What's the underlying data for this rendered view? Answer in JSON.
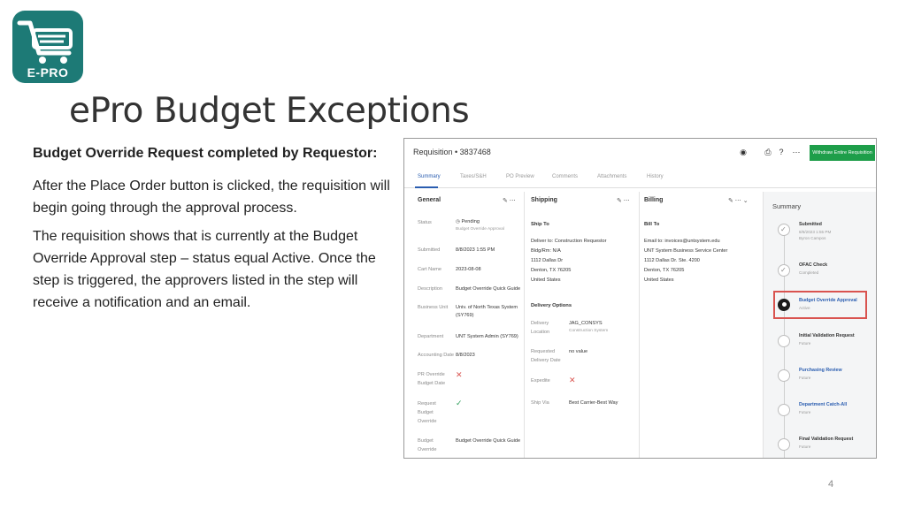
{
  "logo": {
    "text": "E-PRO"
  },
  "slide": {
    "title": "ePro Budget Exceptions",
    "lead": "Budget Override Request completed by Requestor:",
    "para1": "After the Place Order button is clicked, the requisition will begin going through the approval process.",
    "para2": "The requisition shows that is currently at the Budget Override Approval step – status equal Active. Once the step is triggered, the approvers listed in the step will receive a notification and an email.",
    "page_number": "4"
  },
  "screenshot": {
    "requisition_title": "Requisition  •  3837468",
    "header_icons": [
      "eye-icon",
      "print-icon",
      "help-icon",
      "more-icon"
    ],
    "withdraw_button": "Withdraw Entire Requisition",
    "tabs": [
      "Summary",
      "Taxes/S&H",
      "PO Preview",
      "Comments",
      "Attachments",
      "History"
    ],
    "general": {
      "heading": "General",
      "rows": [
        {
          "label": "Status",
          "value": "Pending",
          "sub": "Budget Override Approval"
        },
        {
          "label": "Submitted",
          "value": "8/8/2023 1:55 PM"
        },
        {
          "label": "Cart Name",
          "value": "2023-08-08"
        },
        {
          "label": "Description",
          "value": "Budget Override Quick Guide"
        },
        {
          "label": "Business Unit",
          "value": "Univ. of North Texas System",
          "value2": "(SY769)"
        },
        {
          "label": "Department",
          "value": "UNT System Admin (SY769)"
        },
        {
          "label": "Accounting Date",
          "value": "8/8/2023"
        },
        {
          "label": "PR Override",
          "label2": "Budget Date"
        },
        {
          "label": "Request",
          "label2": "Budget",
          "label3": "Override"
        },
        {
          "label": "Budget",
          "label2": "Override",
          "value": "Budget Override Quick Guide"
        }
      ]
    },
    "shipping": {
      "heading": "Shipping",
      "ship_to_label": "Ship To",
      "address": [
        "Deliver to: Construction Requestor",
        "Bldg/Rm: N/A",
        "1112 Dallas Dr",
        "Denton, TX 76205",
        "United States"
      ],
      "delivery_options_label": "Delivery Options",
      "delivery_location_label": "Delivery",
      "delivery_location_label2": "Location",
      "delivery_location_value": "JAG_CONSYS",
      "delivery_location_sub": "Construction System",
      "requested_date_label": "Requested",
      "requested_date_label2": "Delivery Date",
      "requested_date_value": "no value",
      "expedite_label": "Expedite",
      "ship_via_label": "Ship Via",
      "ship_via_value": "Best Carrier-Best Way"
    },
    "billing": {
      "heading": "Billing",
      "bill_to_label": "Bill To",
      "address": [
        "Email to: invoices@untsystem.edu",
        "UNT System Business Service Center",
        "1112 Dallas Dr. Ste. 4200",
        "Denton, TX 76205",
        "United States"
      ]
    },
    "summary": {
      "title": "Summary",
      "steps": [
        {
          "name": "Submitted",
          "sub": "8/8/2023 1:55 PM",
          "sub2": "Byron Campos",
          "state": "done"
        },
        {
          "name": "OFAC Check",
          "sub": "Completed",
          "state": "done"
        },
        {
          "name": "Budget Override Approval",
          "sub": "Active",
          "state": "active"
        },
        {
          "name": "Initial Validation Request",
          "sub": "Future",
          "state": "future"
        },
        {
          "name": "Purchasing Review",
          "sub": "Future",
          "state": "future"
        },
        {
          "name": "Department Catch-All",
          "sub": "Future",
          "state": "future"
        },
        {
          "name": "Final Validation Request",
          "sub": "Future",
          "state": "future"
        }
      ]
    }
  },
  "colors": {
    "logo_bg": "#1d7a76",
    "withdraw_bg": "#1e9e4a",
    "highlight": "#d9534f",
    "link": "#2a5db0"
  }
}
